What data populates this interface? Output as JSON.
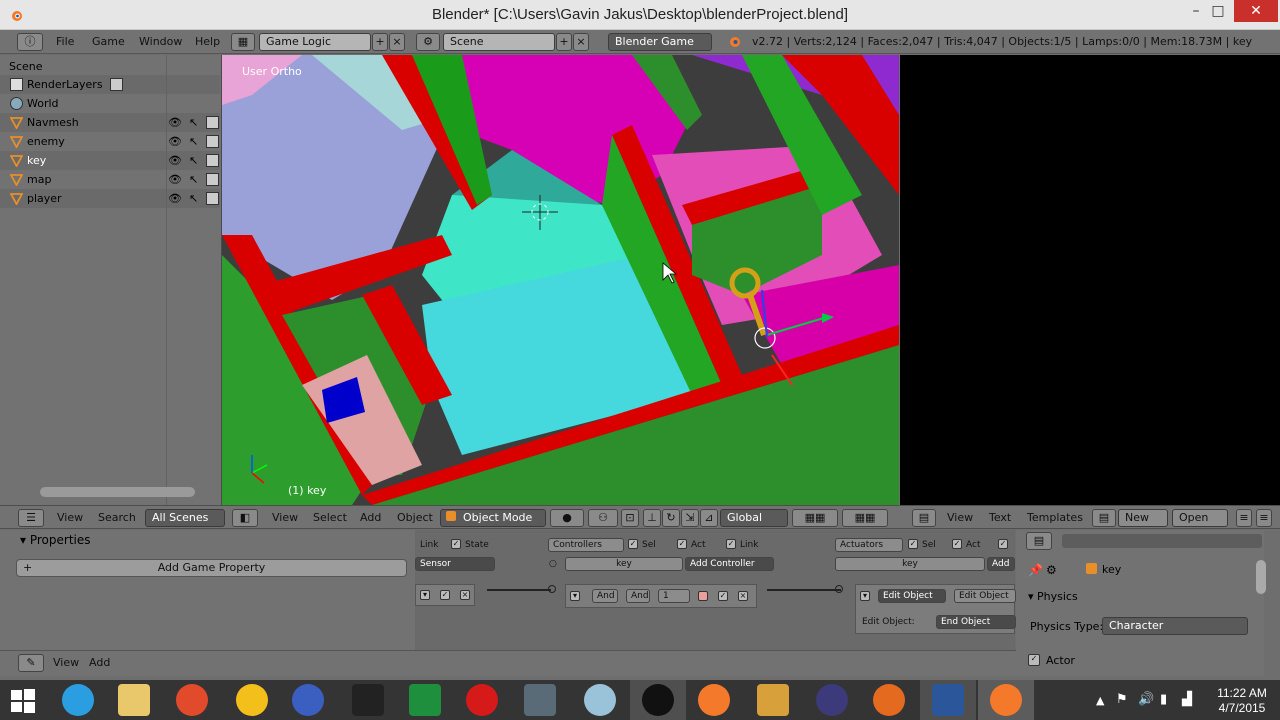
{
  "window": {
    "title": "Blender* [C:\\Users\\Gavin Jakus\\Desktop\\blenderProject.blend]",
    "minimize": "–",
    "maximize": "□",
    "close": "✕"
  },
  "menu": {
    "file": "File",
    "game": "Game",
    "window": "Window",
    "help": "Help"
  },
  "screen_layout": "Game Logic",
  "scene_name": "Scene",
  "engine": "Blender Game",
  "stats": "v2.72 | Verts:2,124 | Faces:2,047 | Tris:4,047 | Objects:1/5 | Lamps:0/0 | Mem:18.73M | key",
  "outliner": {
    "scene": "Scene",
    "items": [
      {
        "label": "RenderLayers",
        "icon": "render-layers-icon"
      },
      {
        "label": "World",
        "icon": "world-icon"
      },
      {
        "label": "Navmesh",
        "icon": "object-icon"
      },
      {
        "label": "enemy",
        "icon": "object-icon"
      },
      {
        "label": "key",
        "icon": "object-icon"
      },
      {
        "label": "map",
        "icon": "object-icon"
      },
      {
        "label": "player",
        "icon": "object-icon"
      }
    ]
  },
  "viewport": {
    "mode_label": "User Ortho",
    "object_label": "(1) key"
  },
  "bar2": {
    "view": "View",
    "search": "Search",
    "all_scenes": "All Scenes",
    "view2": "View",
    "select": "Select",
    "add": "Add",
    "object": "Object",
    "mode": "Object Mode",
    "orientation": "Global",
    "view3": "View",
    "text": "Text",
    "templates": "Templates",
    "new": "New",
    "open": "Open"
  },
  "properties_panel": {
    "header": "Properties",
    "add_game_property": "Add Game Property",
    "view": "View",
    "add": "Add"
  },
  "logic": {
    "link": "Link",
    "state": "State",
    "controllers": "Controllers",
    "sel": "Sel",
    "act": "Act",
    "link2": "Link",
    "actuators": "Actuators",
    "sensor": "Sensor",
    "key_ctrl": "key",
    "add_controller": "Add Controller",
    "key_act": "key",
    "add_actuator": "Add A",
    "and1": "And",
    "and2": "And",
    "num": "1",
    "edit_object": "Edit Object",
    "edit_object2": "Edit Object",
    "edit_object_label": "Edit Object:",
    "end_object": "End Object"
  },
  "physics": {
    "object": "key",
    "section": "Physics",
    "type_label": "Physics Type:",
    "type_value": "Character",
    "actor": "Actor"
  },
  "clock": {
    "time": "11:22 AM",
    "date": "4/7/2015"
  },
  "colors": {
    "wall_red": "#e10000",
    "wall_green": "#1a9b1a",
    "floor_magenta": "#d100a8",
    "floor_cyan": "#3be8d0",
    "key_gold": "#d4a017"
  }
}
